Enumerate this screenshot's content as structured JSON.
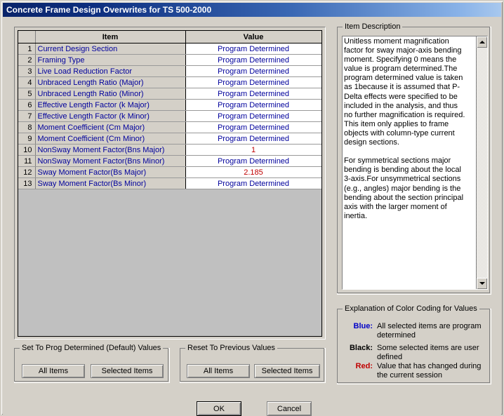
{
  "window": {
    "title": "Concrete Frame Design Overwrites for TS 500-2000"
  },
  "grid": {
    "headers": {
      "num": "",
      "item": "Item",
      "value": "Value"
    },
    "rows": [
      {
        "num": "1",
        "item": "Current Design Section",
        "value": "Program Determined",
        "color": "blue"
      },
      {
        "num": "2",
        "item": "Framing Type",
        "value": "Program Determined",
        "color": "blue"
      },
      {
        "num": "3",
        "item": "Live Load Reduction Factor",
        "value": "Program Determined",
        "color": "blue"
      },
      {
        "num": "4",
        "item": "Unbraced Length Ratio (Major)",
        "value": "Program Determined",
        "color": "blue"
      },
      {
        "num": "5",
        "item": "Unbraced Length Ratio (Minor)",
        "value": "Program Determined",
        "color": "blue"
      },
      {
        "num": "6",
        "item": "Effective Length Factor (k Major)",
        "value": "Program Determined",
        "color": "blue"
      },
      {
        "num": "7",
        "item": "Effective Length Factor (k Minor)",
        "value": "Program Determined",
        "color": "blue"
      },
      {
        "num": "8",
        "item": "Moment Coefficient (Cm Major)",
        "value": "Program Determined",
        "color": "blue"
      },
      {
        "num": "9",
        "item": "Moment Coefficient (Cm Minor)",
        "value": "Program Determined",
        "color": "blue"
      },
      {
        "num": "10",
        "item": "NonSway Moment Factor(Bns Major)",
        "value": "1",
        "color": "red"
      },
      {
        "num": "11",
        "item": "NonSway Moment Factor(Bns Minor)",
        "value": "Program Determined",
        "color": "blue"
      },
      {
        "num": "12",
        "item": "Sway Moment Factor(Bs Major)",
        "value": "2.185",
        "color": "red"
      },
      {
        "num": "13",
        "item": "Sway Moment Factor(Bs Minor)",
        "value": "Program Determined",
        "color": "blue"
      }
    ]
  },
  "description": {
    "legend": "Item Description",
    "text": "Unitless moment magnification factor for sway major-axis bending moment. Specifying 0 means the value is program determined.The program determined value is taken as 1because it is assumed that P-Delta effects were specified to be included in the analysis, and thus no further magnification is required.  This item only applies to frame objects with column-type current design sections.\n\nFor symmetrical sections major bending is bending about the local 3-axis.For unsymmetrical sections (e.g., angles) major bending is the bending about the section principal axis with the larger moment of inertia."
  },
  "color_legend": {
    "legend": "Explanation of Color Coding for Values",
    "entries": [
      {
        "key": "Blue:",
        "desc": "All selected items are program determined"
      },
      {
        "key": "Black:",
        "desc": "Some selected items are user defined"
      },
      {
        "key": "Red:",
        "desc": "Value that has changed during the current session"
      }
    ],
    "colors": {
      "blue": "#0000c8",
      "black": "#000000",
      "red": "#c00000"
    }
  },
  "set_prog_group": {
    "legend": "Set To Prog Determined (Default) Values",
    "all_items": "All Items",
    "selected_items": "Selected Items"
  },
  "reset_group": {
    "legend": "Reset To Previous Values",
    "all_items": "All Items",
    "selected_items": "Selected Items"
  },
  "dialog_buttons": {
    "ok": "OK",
    "cancel": "Cancel"
  },
  "scrollbar": {
    "up_icon": "triangle-up-icon",
    "down_icon": "triangle-down-icon"
  }
}
